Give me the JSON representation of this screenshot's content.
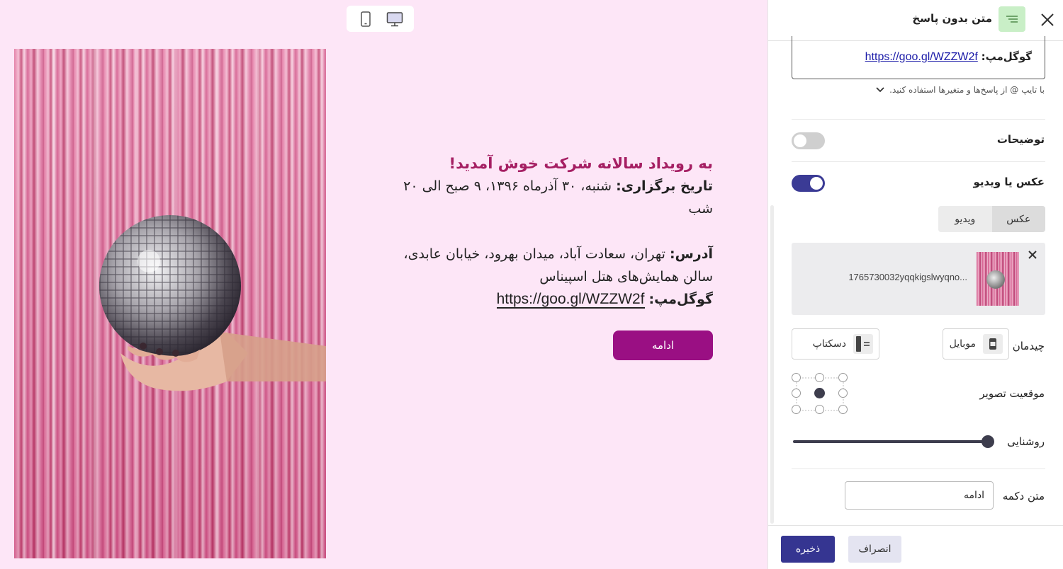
{
  "preview": {
    "device_toggle": {
      "mobile_icon": "mobile-icon",
      "desktop_icon": "desktop-icon",
      "selected": "desktop"
    },
    "welcome": "به رویداد سالانه شرکت خوش آمدید!",
    "date_label": "تاریخ برگزاری:",
    "date_value": " شنبه، ۳۰ آذرماه ۱۳۹۶، ۹ صبح الی ۲۰ شب",
    "address_label": "آدرس:",
    "address_value": " تهران، سعادت آباد، میدان بهرود، خیابان عابدی، سالن همایش‌های هتل اسپیناس",
    "map_label": "گوگل‌مپ:",
    "map_link": "https://goo.gl/WZZW2f",
    "continue_button": "ادامه"
  },
  "panel": {
    "title": "متن بدون پاسخ",
    "type_icon": "text-lines-icon",
    "map_label": "گوگل‌مپ:",
    "map_link": "https://goo.gl/WZZW2f",
    "hint": "با تایپ @ از پاسخ‌ها و متغیرها استفاده کنید.",
    "description_label": "توضیحات",
    "description_enabled": false,
    "media_label": "عکس یا ویدیو",
    "media_enabled": true,
    "media_tabs": [
      "عکس",
      "ویدیو"
    ],
    "media_tab_selected": "عکس",
    "file_name": "1765730032yqqkigslwyqno...",
    "layout_label": "چیدمان",
    "layout_mobile": "موبایل",
    "layout_desktop": "دسکتاپ",
    "position_label": "موقعیت تصویر",
    "position_selected": "center",
    "brightness_label": "روشنایی",
    "brightness_value": 1.0,
    "button_text_label": "متن دکمه",
    "button_text_value": "ادامه",
    "save_button": "ذخیره",
    "cancel_button": "انصراف"
  },
  "colors": {
    "preview_bg": "#fde6f7",
    "welcome_text": "#a51f63",
    "continue_button": "#9a0f83",
    "save_button": "#353591",
    "toggle_on": "#3b3b95",
    "badge_bg": "#c9efc7"
  }
}
